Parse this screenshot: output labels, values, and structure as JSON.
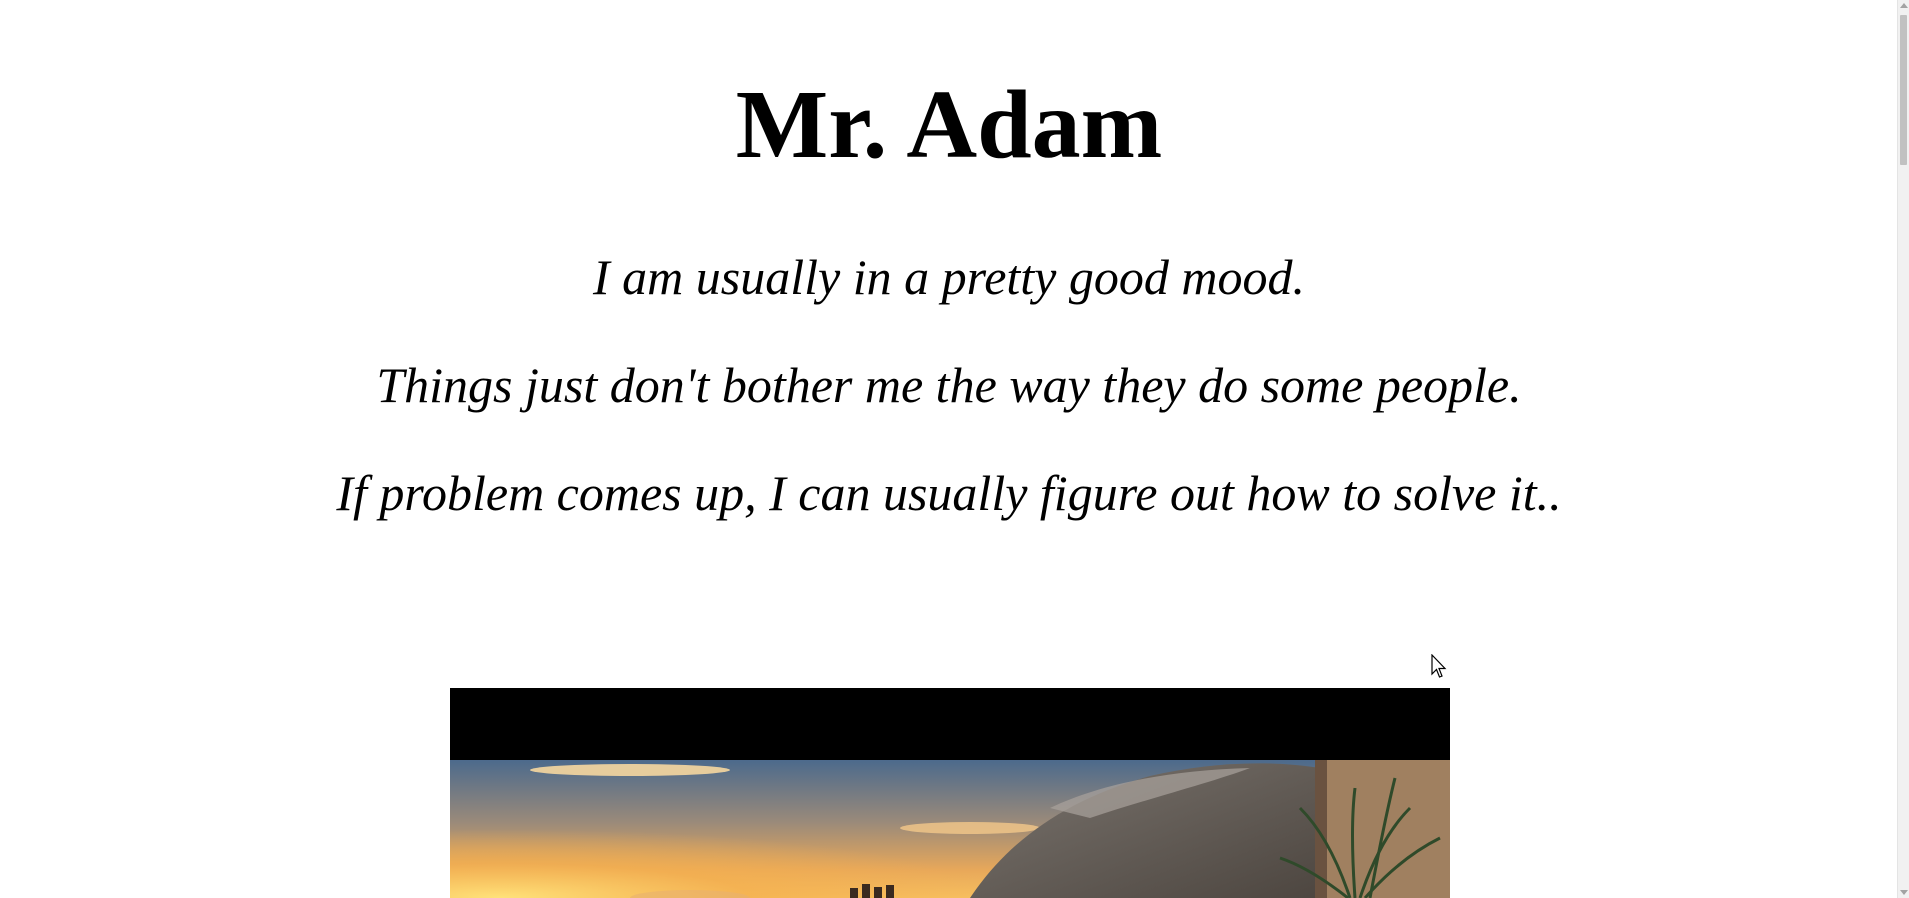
{
  "profile": {
    "title": "Mr. Adam",
    "lines": [
      "I am usually in a pretty good mood.",
      "Things just don't bother me the way they do some people.",
      "If problem comes up, I can usually figure out how to solve it.."
    ]
  },
  "video": {
    "icon": "video-thumbnail-sunset-scene"
  },
  "colors": {
    "background": "#ffffff",
    "text": "#000000",
    "video_letterbox": "#000000"
  }
}
